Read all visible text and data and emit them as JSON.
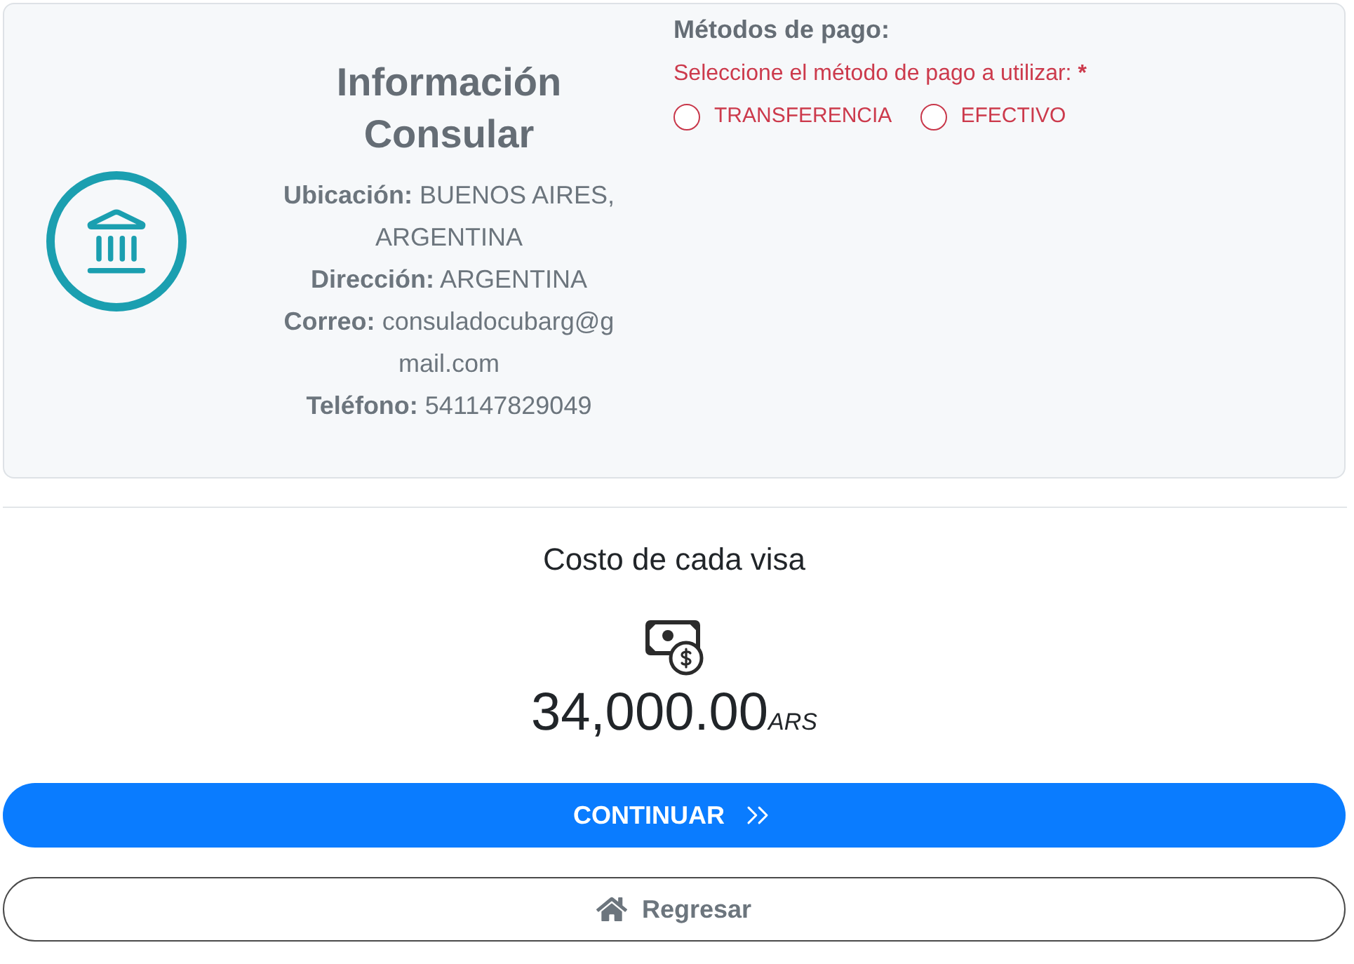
{
  "consular_info": {
    "title": "Información Consular",
    "fields": [
      "**Ubicación:** BUENOS AIRES, ARGENTINA",
      "**Dirección:** ARGENTINA",
      "**Correo:** consuladocubarg@gmail.com",
      "**Teléfono:** 541147829049"
    ]
  },
  "payment_methods": {
    "heading": "Métodos de pago:",
    "prompt": "Seleccione el método de pago a utilizar:",
    "required_mark": "*",
    "options": [
      {
        "label": "TRANSFERENCIA",
        "selected": false
      },
      {
        "label": "EFECTIVO",
        "selected": false
      }
    ]
  },
  "cost": {
    "title": "Costo de cada visa",
    "amount": "34,000.00",
    "currency": "ARS"
  },
  "buttons": [
    {
      "kind": "primary",
      "label": "CONTINUAR"
    },
    {
      "kind": "secondary",
      "label": "Regresar"
    }
  ]
}
